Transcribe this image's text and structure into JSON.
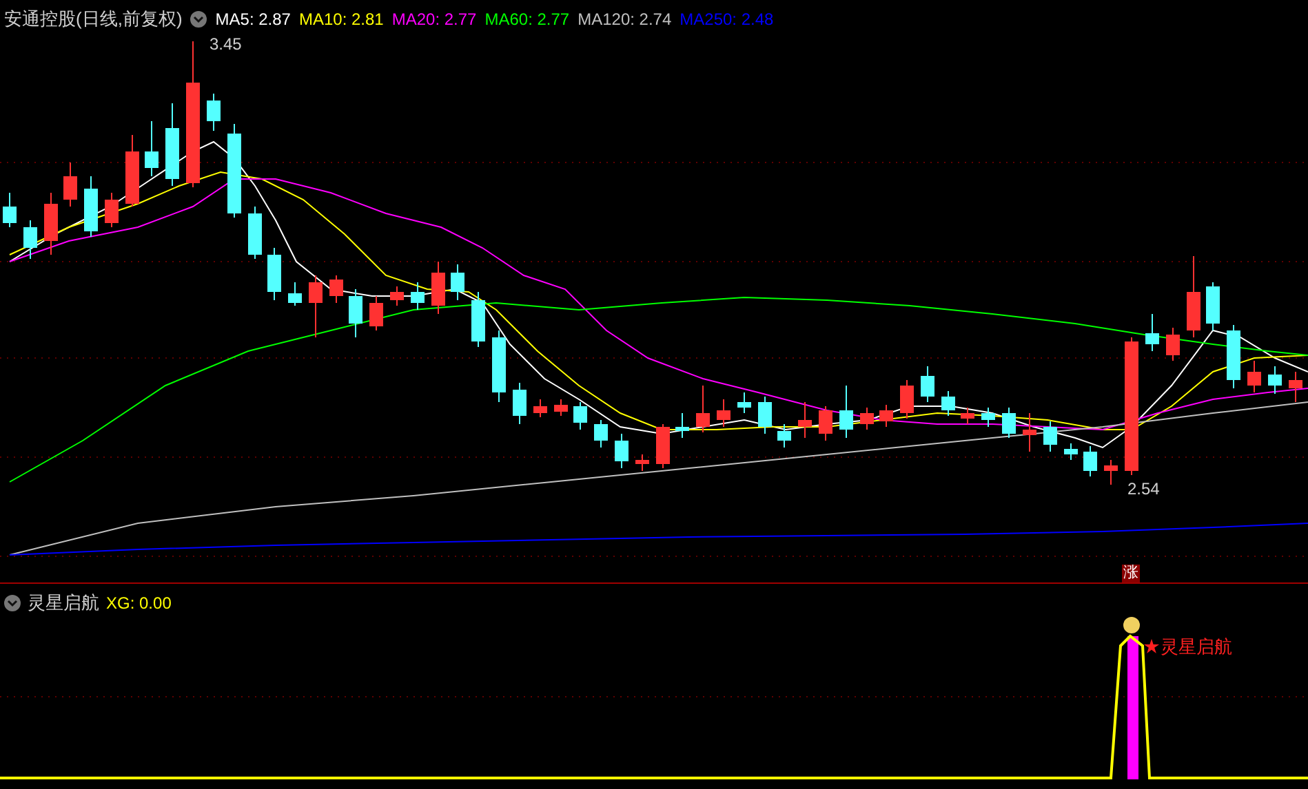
{
  "main_panel": {
    "title": "安通控股(日线,前复权)",
    "moving_averages": [
      {
        "label": "MA5: 2.87",
        "color": "#ffffff"
      },
      {
        "label": "MA10: 2.81",
        "color": "#ffff00"
      },
      {
        "label": "MA20: 2.77",
        "color": "#ff00ff"
      },
      {
        "label": "MA60: 2.77",
        "color": "#00ff00"
      },
      {
        "label": "MA120: 2.74",
        "color": "#c0c0c0"
      },
      {
        "label": "MA250: 2.48",
        "color": "#0000ff"
      }
    ],
    "high_label": "3.45",
    "low_label": "2.54",
    "badge": "涨"
  },
  "indicator_panel": {
    "title": "灵星启航",
    "value": "XG: 0.00",
    "signal_label": "灵星启航"
  }
}
